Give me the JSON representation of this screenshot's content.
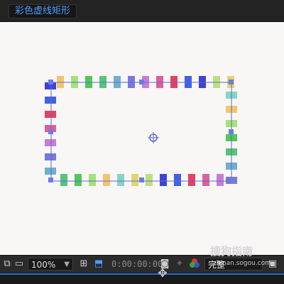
{
  "window": {
    "tab_title": "彩色虚线矩形"
  },
  "toolbar": {
    "zoom_value": "100%",
    "timecode": "0:00:00:00",
    "quality_value": "完整",
    "icons": [
      "snapshot-icon",
      "monitor-icon",
      "zoom-dropdown-arrow-icon",
      "grid-toggle-icon",
      "mask-toggle-icon",
      "camera-icon",
      "show-snapshot-icon",
      "color-channels-icon",
      "quality-dropdown-arrow-icon",
      "view-options-icon"
    ]
  },
  "watermark": {
    "brand": "搜狗指南",
    "url": "zhinan.sogou.com"
  },
  "canvas": {
    "shape": "rectangle",
    "stroke": "dashed",
    "dash_colors": [
      "#f0c060",
      "#9be06a",
      "#3fc24a",
      "#44c06e",
      "#5fa8c8",
      "#6a6ad8",
      "#c070d0",
      "#d85090",
      "#e03050",
      "#3050e0",
      "#2a30d0",
      "#b0e070",
      "#e0d060",
      "#7ad0c0"
    ],
    "path_color": "#5a6ad0",
    "anchor_color": "#6a7ee0"
  }
}
